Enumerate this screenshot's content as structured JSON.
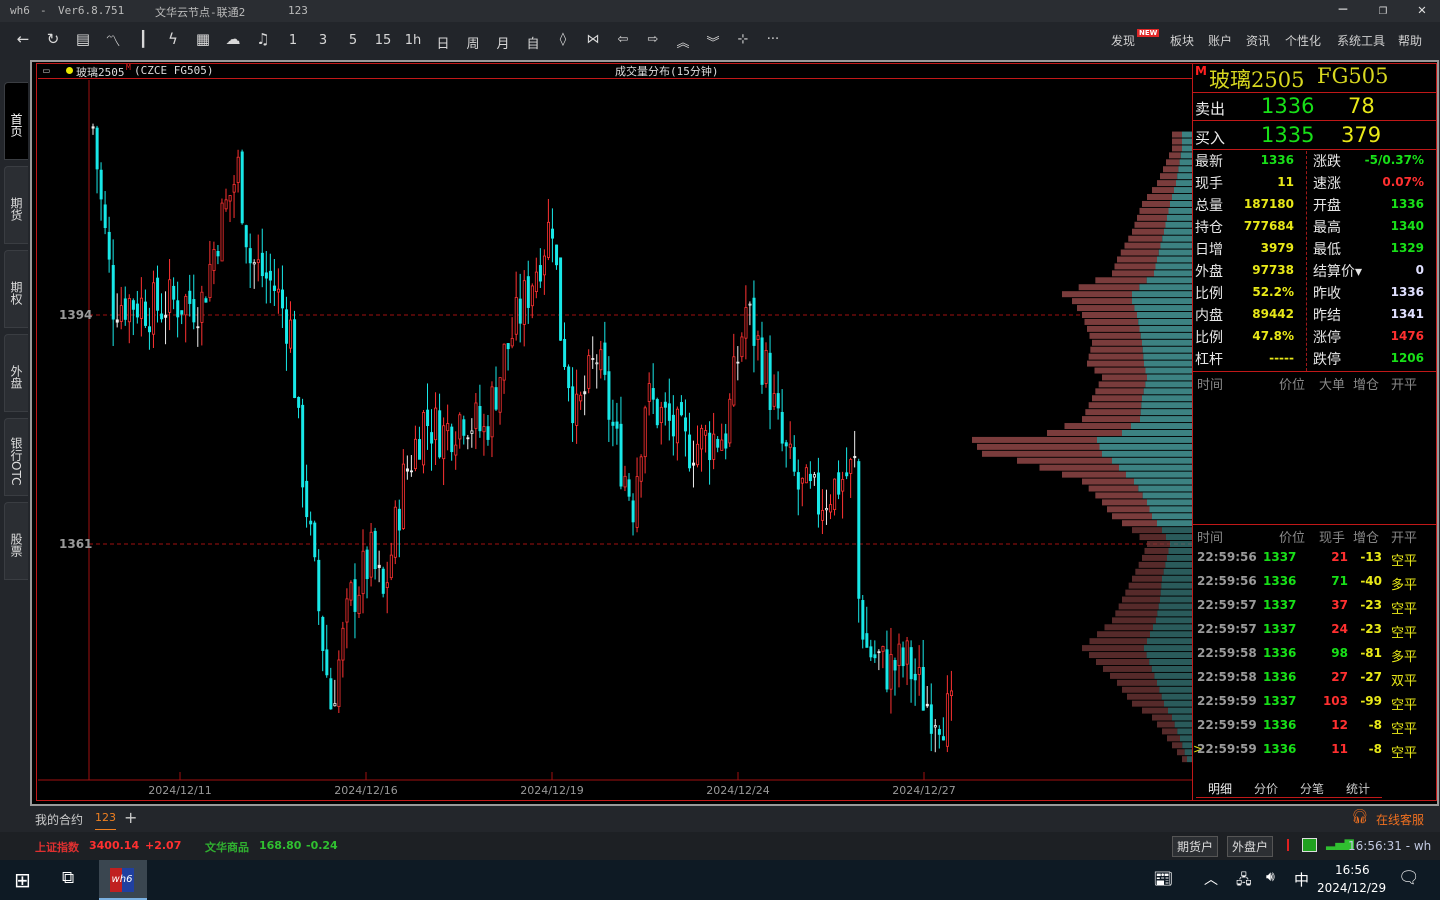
{
  "titlebar": {
    "app": "wh6",
    "version": "Ver6.8.751",
    "server": "文华云节点-联通2",
    "account": "123",
    "minimize": "─",
    "maximize": "❐",
    "close": "✕"
  },
  "toolbar": {
    "icons": [
      {
        "name": "back-icon",
        "glyph": "←"
      },
      {
        "name": "refresh-icon",
        "glyph": "↻"
      },
      {
        "name": "list-icon",
        "glyph": "▤"
      },
      {
        "name": "line-chart-icon",
        "glyph": "〽"
      },
      {
        "name": "candlestick-icon",
        "glyph": "┃"
      },
      {
        "name": "lightning-icon",
        "glyph": "ϟ"
      },
      {
        "name": "order-icon",
        "glyph": "▦"
      },
      {
        "name": "cloud-icon",
        "glyph": "☁"
      },
      {
        "name": "bell-icon",
        "glyph": "♫"
      }
    ],
    "periods": [
      "1",
      "3",
      "5",
      "15",
      "1h",
      "日",
      "周",
      "月",
      "自"
    ],
    "tools": [
      {
        "name": "zoom-icon",
        "glyph": "◊"
      },
      {
        "name": "shrink-icon",
        "glyph": "⋈"
      },
      {
        "name": "left-icon",
        "glyph": "⇦"
      },
      {
        "name": "right-icon",
        "glyph": "⇨"
      },
      {
        "name": "up-icon",
        "glyph": "︽"
      },
      {
        "name": "down-icon",
        "glyph": "︾"
      },
      {
        "name": "crosshair-icon",
        "glyph": "⊹"
      },
      {
        "name": "more-icon",
        "glyph": "···"
      }
    ],
    "menu": [
      "发现",
      "板块",
      "账户",
      "资讯",
      "个性化",
      "系统工具",
      "帮助"
    ],
    "new_badge": "NEW"
  },
  "sidebar": [
    "首页",
    "期货",
    "期权",
    "外盘",
    "银行OTC",
    "股票"
  ],
  "chart": {
    "symbol": "玻璃2505",
    "marker": "M",
    "exchange": "(CZCE FG505)",
    "title": "成交量分布(15分钟)",
    "y_labels": [
      {
        "value": 1394,
        "text": "1394"
      },
      {
        "value": 1361,
        "text": "1361"
      }
    ],
    "x_labels": [
      "2024/12/11",
      "2024/12/16",
      "2024/12/19",
      "2024/12/24",
      "2024/12/27"
    ]
  },
  "chart_data": {
    "type": "candlestick",
    "ylim": [
      1329,
      1426
    ],
    "price_path": [
      [
        0,
        1421
      ],
      [
        2,
        1410
      ],
      [
        5,
        1396
      ],
      [
        10,
        1396
      ],
      [
        15,
        1395
      ],
      [
        21,
        1396
      ],
      [
        27,
        1396
      ],
      [
        31,
        1406
      ],
      [
        36,
        1415
      ],
      [
        39,
        1402
      ],
      [
        45,
        1398
      ],
      [
        49,
        1392
      ],
      [
        51,
        1377
      ],
      [
        55,
        1356
      ],
      [
        59,
        1338
      ],
      [
        64,
        1353
      ],
      [
        69,
        1359
      ],
      [
        72,
        1353
      ],
      [
        77,
        1370
      ],
      [
        82,
        1379
      ],
      [
        87,
        1377
      ],
      [
        92,
        1380
      ],
      [
        97,
        1377
      ],
      [
        102,
        1388
      ],
      [
        107,
        1396
      ],
      [
        114,
        1408
      ],
      [
        116,
        1392
      ],
      [
        120,
        1379
      ],
      [
        125,
        1388
      ],
      [
        130,
        1375
      ],
      [
        134,
        1367
      ],
      [
        137,
        1382
      ],
      [
        142,
        1379
      ],
      [
        147,
        1375
      ],
      [
        152,
        1376
      ],
      [
        157,
        1377
      ],
      [
        162,
        1395
      ],
      [
        167,
        1386
      ],
      [
        171,
        1375
      ],
      [
        175,
        1369
      ],
      [
        180,
        1367
      ],
      [
        185,
        1370
      ],
      [
        189,
        1372
      ],
      [
        190,
        1353
      ],
      [
        192,
        1346
      ],
      [
        197,
        1343
      ],
      [
        202,
        1344
      ],
      [
        207,
        1338
      ],
      [
        213,
        1336
      ]
    ],
    "volume_profile": [
      [
        1418,
        20,
        10
      ],
      [
        1413,
        35,
        16
      ],
      [
        1410,
        50,
        22
      ],
      [
        1406,
        60,
        28
      ],
      [
        1402,
        75,
        35
      ],
      [
        1400,
        80,
        38
      ],
      [
        1397,
        130,
        60
      ],
      [
        1396,
        120,
        60
      ],
      [
        1394,
        110,
        55
      ],
      [
        1390,
        100,
        50
      ],
      [
        1387,
        105,
        48
      ],
      [
        1385,
        90,
        45
      ],
      [
        1382,
        100,
        50
      ],
      [
        1379,
        110,
        52
      ],
      [
        1377,
        145,
        70
      ],
      [
        1376,
        220,
        95
      ],
      [
        1374,
        210,
        90
      ],
      [
        1373,
        175,
        80
      ],
      [
        1371,
        130,
        66
      ],
      [
        1370,
        110,
        58
      ],
      [
        1367,
        90,
        45
      ],
      [
        1365,
        80,
        40
      ],
      [
        1363,
        60,
        30
      ],
      [
        1361,
        45,
        22
      ],
      [
        1359,
        50,
        25
      ],
      [
        1356,
        60,
        30
      ],
      [
        1353,
        70,
        32
      ],
      [
        1350,
        80,
        36
      ],
      [
        1346,
        110,
        48
      ],
      [
        1341,
        75,
        35
      ],
      [
        1338,
        60,
        28
      ],
      [
        1336,
        40,
        20
      ],
      [
        1333,
        25,
        12
      ],
      [
        1330,
        10,
        5
      ]
    ]
  },
  "quote": {
    "marker": "M",
    "name": "玻璃2505",
    "code": "FG505",
    "ask": {
      "label": "卖出",
      "price": "1336",
      "vol": "78"
    },
    "bid": {
      "label": "买入",
      "price": "1335",
      "vol": "379"
    },
    "left": [
      {
        "l": "最新",
        "v": "1336",
        "c": "#18e018"
      },
      {
        "l": "现手",
        "v": "11",
        "c": "#e8e818"
      },
      {
        "l": "总量",
        "v": "187180",
        "c": "#e8e818"
      },
      {
        "l": "持仓",
        "v": "777684",
        "c": "#e8e818"
      },
      {
        "l": "日增",
        "v": "3979",
        "c": "#e8e818"
      },
      {
        "l": "外盘",
        "v": "97738",
        "c": "#e8e818"
      },
      {
        "l": "比例",
        "v": "52.2%",
        "c": "#e8e818"
      },
      {
        "l": "内盘",
        "v": "89442",
        "c": "#e8e818"
      },
      {
        "l": "比例",
        "v": "47.8%",
        "c": "#e8e818"
      },
      {
        "l": "杠杆",
        "v": "-----",
        "c": "#e8e818"
      }
    ],
    "right": [
      {
        "l": "涨跌",
        "v": "-5/0.37%",
        "c": "#18e018"
      },
      {
        "l": "速涨",
        "v": "0.07%",
        "c": "#ff3030"
      },
      {
        "l": "开盘",
        "v": "1336",
        "c": "#18e018"
      },
      {
        "l": "最高",
        "v": "1340",
        "c": "#18e018"
      },
      {
        "l": "最低",
        "v": "1329",
        "c": "#18e018"
      },
      {
        "l": "结算价▾",
        "v": "0",
        "c": "#e0e0ff"
      },
      {
        "l": "昨收",
        "v": "1336",
        "c": "#e0e0ff"
      },
      {
        "l": "昨结",
        "v": "1341",
        "c": "#e0e0ff"
      },
      {
        "l": "涨停",
        "v": "1476",
        "c": "#ff3030"
      },
      {
        "l": "跌停",
        "v": "1206",
        "c": "#18e018"
      }
    ]
  },
  "bigorders": {
    "headers": [
      "时间",
      "价位",
      "大单",
      "增仓",
      "开平"
    ]
  },
  "ticks": {
    "headers": [
      "时间",
      "价位",
      "现手",
      "增仓",
      "开平"
    ],
    "rows": [
      {
        "t": "22:59:56",
        "p": "1337",
        "v": "21",
        "vc": "#ff3030",
        "d": "-13",
        "o": "空平"
      },
      {
        "t": "22:59:56",
        "p": "1336",
        "v": "71",
        "vc": "#18e018",
        "d": "-40",
        "o": "多平"
      },
      {
        "t": "22:59:57",
        "p": "1337",
        "v": "37",
        "vc": "#ff3030",
        "d": "-23",
        "o": "空平"
      },
      {
        "t": "22:59:57",
        "p": "1337",
        "v": "24",
        "vc": "#ff3030",
        "d": "-23",
        "o": "空平"
      },
      {
        "t": "22:59:58",
        "p": "1336",
        "v": "98",
        "vc": "#18e018",
        "d": "-81",
        "o": "多平"
      },
      {
        "t": "22:59:58",
        "p": "1336",
        "v": "27",
        "vc": "#ff3030",
        "d": "-27",
        "o": "双平"
      },
      {
        "t": "22:59:59",
        "p": "1337",
        "v": "103",
        "vc": "#ff3030",
        "d": "-99",
        "o": "空平"
      },
      {
        "t": "22:59:59",
        "p": "1336",
        "v": "12",
        "vc": "#ff3030",
        "d": "-8",
        "o": "空平"
      },
      {
        "t": "22:59:59",
        "p": "1336",
        "v": "11",
        "vc": "#ff3030",
        "d": "-8",
        "o": "空平"
      }
    ],
    "tabs": [
      "明细",
      "分价",
      "分笔",
      "统计"
    ]
  },
  "contracts": {
    "label": "我的合约",
    "tab": "123",
    "add": "+",
    "service": "在线客服"
  },
  "status": {
    "idx1_name": "上证指数",
    "idx1_val": "3400.14",
    "idx1_chg": "+2.07",
    "idx2_name": "文华商品",
    "idx2_val": "168.80",
    "idx2_chg": "-0.24",
    "btn1": "期货户",
    "btn2": "外盘户",
    "clock": "16:56:31 - wh"
  },
  "taskbar": {
    "app": "wh6",
    "ime": "中",
    "time": "16:56",
    "date": "2024/12/29"
  },
  "colors": {
    "up": "#ff3232",
    "down": "#18e8e8",
    "profile_sell": "#7a3c3c",
    "profile_buy": "#3c8282",
    "grid": "#a01010"
  }
}
